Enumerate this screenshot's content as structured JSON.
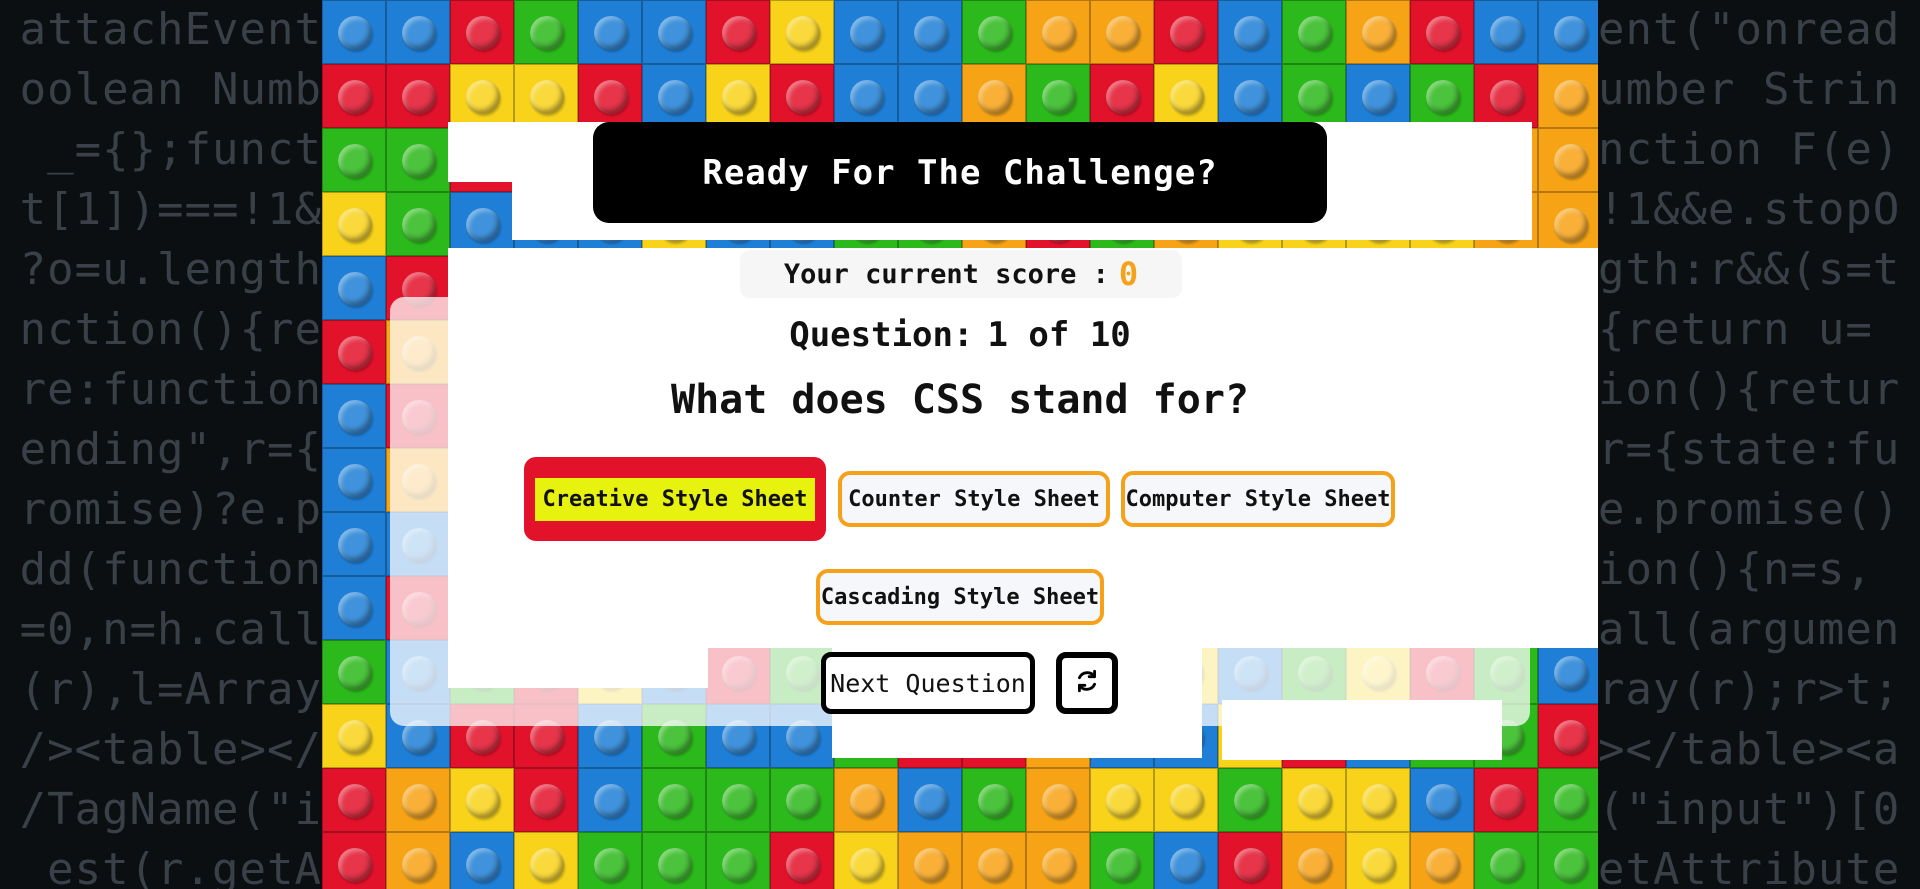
{
  "background_code": {
    "left_lines": [
      "attachEvent",
      "oolean Numb",
      "_={};funct",
      "t[1])===!1&",
      "?o=u.length",
      "nction(){re",
      "re:function",
      "ending\",r={",
      "romise)?e.p",
      "dd(function",
      "=0,n=h.call",
      "(r),l=Array",
      "/><table></",
      "/TagName(\"i",
      "est(r.getA"
    ],
    "right_lines": [
      "ent(\"onread",
      "umber Strin",
      "nction F(e)",
      "!1&&e.stopO",
      "gth:r&&(s=t",
      "{return u=",
      "ion(){retur",
      "r={state:fu",
      "e.promise()",
      "ion(){n=s,",
      "all(argumen",
      "ray(r);r>t;",
      "></table><a",
      "(\"input\")[0",
      "etAttribute"
    ]
  },
  "header": {
    "title": "Ready For The Challenge?"
  },
  "score": {
    "label": "Your current score :",
    "value": "0"
  },
  "progress": {
    "label": "Question:",
    "value": "1 of 10"
  },
  "question": {
    "text": "What does CSS stand for?"
  },
  "answers": [
    {
      "label": "Creative Style Sheet",
      "selected": true
    },
    {
      "label": "Counter Style Sheet",
      "selected": false
    },
    {
      "label": "Computer Style Sheet",
      "selected": false
    },
    {
      "label": "Cascading Style Sheet",
      "selected": false
    }
  ],
  "controls": {
    "next_label": "Next Question",
    "reset_icon": "refresh-icon"
  },
  "colors": {
    "accent_orange": "#f5a11a",
    "selected_red": "#e3122b",
    "selected_highlight": "#e7f20e",
    "title_bg": "#000000"
  }
}
